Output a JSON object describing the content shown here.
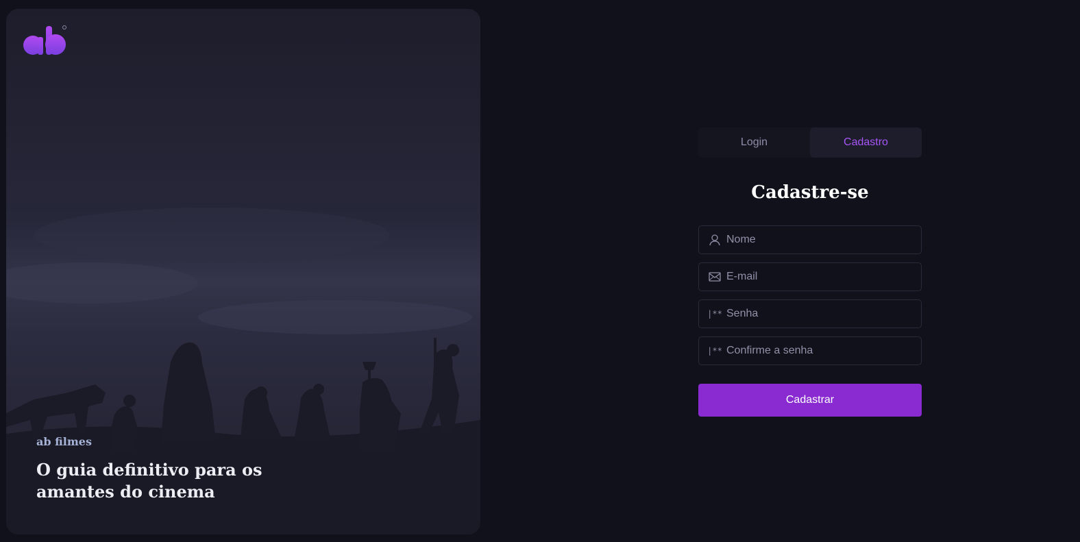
{
  "brand": {
    "logo_text": "ab",
    "name": "ab filmes",
    "tagline": "O guia definitivo para os amantes do cinema"
  },
  "tabs": [
    {
      "label": "Login",
      "active": false
    },
    {
      "label": "Cadastro",
      "active": true
    }
  ],
  "form": {
    "title": "Cadastre-se",
    "fields": [
      {
        "icon": "user-icon",
        "placeholder": "Nome",
        "value": ""
      },
      {
        "icon": "mail-icon",
        "placeholder": "E-mail",
        "value": ""
      },
      {
        "icon": "password-icon",
        "placeholder": "Senha",
        "value": ""
      },
      {
        "icon": "password-icon",
        "placeholder": "Confirme a senha",
        "value": ""
      }
    ],
    "password_icon_glyph": "|**",
    "submit_label": "Cadastrar"
  },
  "colors": {
    "background": "#11111b",
    "accent": "#8a2bd2",
    "accent_text": "#a855f7",
    "logo_gradient": [
      "#b04af0",
      "#7a3fe0"
    ]
  }
}
